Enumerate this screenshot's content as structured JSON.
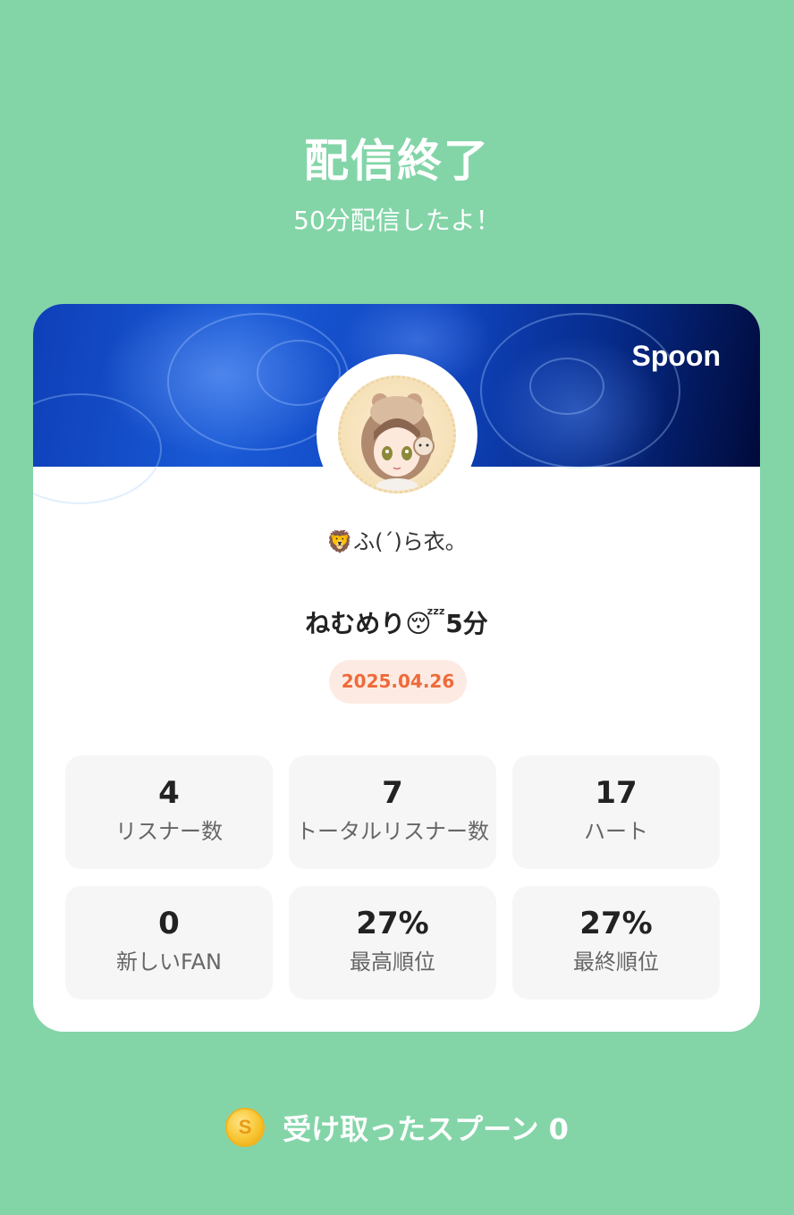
{
  "header": {
    "title": "配信終了",
    "subtitle": "50分配信したよ！"
  },
  "card": {
    "brand": "Spoon",
    "username": "🦁ふ(ˊ)ら衣。",
    "stream_title": "ねむめり😴5分",
    "date": "2025.04.26",
    "stats": [
      {
        "value": "4",
        "label": "リスナー数"
      },
      {
        "value": "7",
        "label": "トータルリスナー数"
      },
      {
        "value": "17",
        "label": "ハート"
      },
      {
        "value": "0",
        "label": "新しいFAN"
      },
      {
        "value": "27%",
        "label": "最高順位"
      },
      {
        "value": "27%",
        "label": "最終順位"
      }
    ]
  },
  "footer": {
    "coin_symbol": "S",
    "spoon_label": "受け取ったスプーン",
    "spoon_count": "0"
  }
}
